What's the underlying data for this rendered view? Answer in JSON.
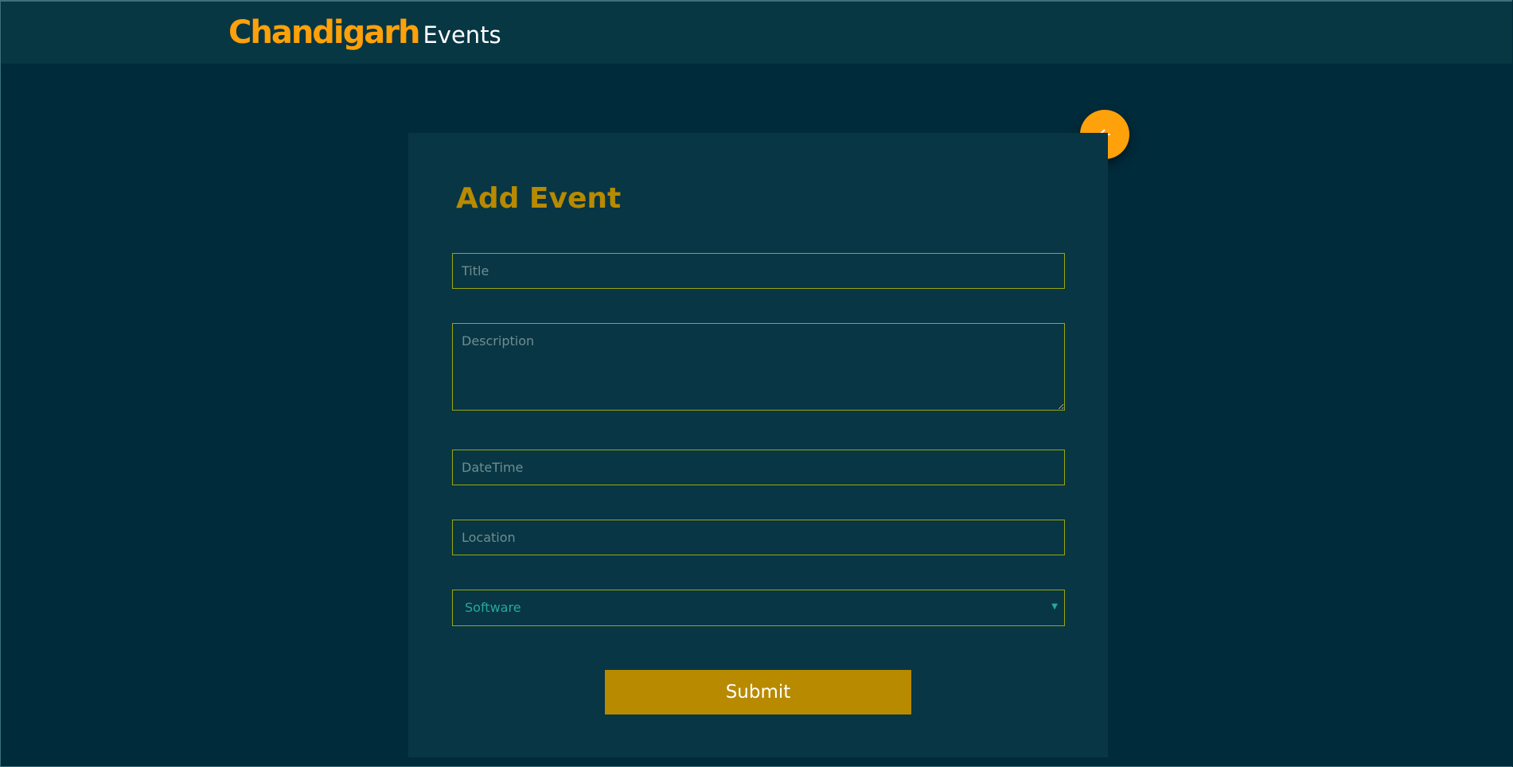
{
  "header": {
    "brand_main": "Chandigarh",
    "brand_sub": "Events"
  },
  "form": {
    "title": "Add Event",
    "fields": {
      "title_placeholder": "Title",
      "description_placeholder": "Description",
      "datetime_placeholder": "DateTime",
      "location_placeholder": "Location"
    },
    "category": {
      "selected": "Software"
    },
    "submit_label": "Submit"
  },
  "icons": {
    "back": "arrow-left-icon",
    "dropdown": "caret-down-icon"
  },
  "colors": {
    "accent": "#ffa10a",
    "heading": "#b88a00",
    "field_border": "#9aa70e",
    "select_text": "#27a8a0",
    "background": "#002b3a",
    "surface": "#083644"
  }
}
